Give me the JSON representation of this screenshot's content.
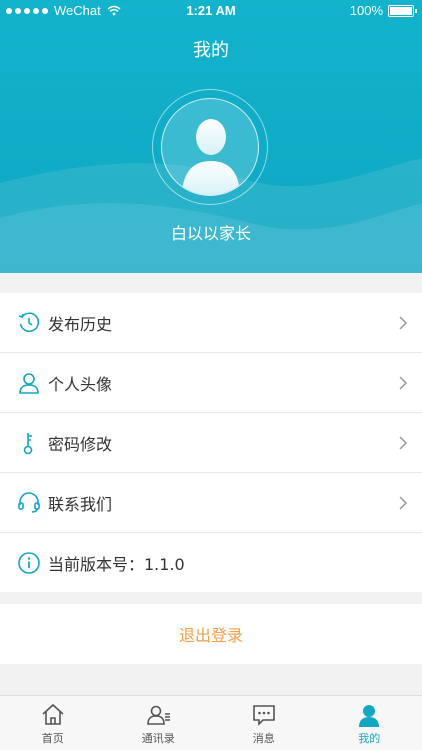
{
  "status_bar": {
    "carrier": "WeChat",
    "time": "1:21 AM",
    "battery": "100%"
  },
  "header": {
    "title": "我的",
    "username": "白以以家长"
  },
  "menu": [
    {
      "label": "发布历史",
      "icon": "history-icon"
    },
    {
      "label": "个人头像",
      "icon": "person-icon"
    },
    {
      "label": "密码修改",
      "icon": "key-icon"
    },
    {
      "label": "联系我们",
      "icon": "headset-icon"
    },
    {
      "label": "当前版本号：1.1.0",
      "icon": "info-icon"
    }
  ],
  "logout_label": "退出登录",
  "tabs": [
    {
      "label": "首页",
      "icon": "home-icon"
    },
    {
      "label": "通讯录",
      "icon": "contacts-icon"
    },
    {
      "label": "消息",
      "icon": "message-icon"
    },
    {
      "label": "我的",
      "icon": "profile-icon",
      "active": true
    }
  ],
  "colors": {
    "accent": "#13a7c3",
    "logout": "#f2a04a"
  }
}
